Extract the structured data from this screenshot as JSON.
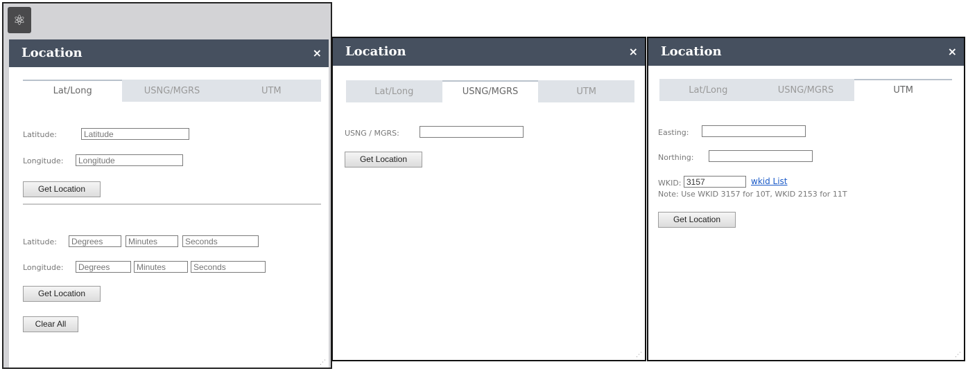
{
  "toolbar": {
    "icon": "location-tool-icon"
  },
  "panel1": {
    "title": "Location",
    "close": "×",
    "tabs": [
      "Lat/Long",
      "USNG/MGRS",
      "UTM"
    ],
    "active_tab": "Lat/Long",
    "decimal": {
      "lat_label": "Latitude:",
      "lat_placeholder": "Latitude",
      "lon_label": "Longitude:",
      "lon_placeholder": "Longitude",
      "button": "Get Location"
    },
    "dms": {
      "lat_label": "Latitude:",
      "lon_label": "Longitude:",
      "deg": "Degrees",
      "min": "Minutes",
      "sec": "Seconds",
      "button": "Get Location",
      "clear": "Clear All"
    }
  },
  "panel2": {
    "title": "Location",
    "close": "×",
    "tabs": [
      "Lat/Long",
      "USNG/MGRS",
      "UTM"
    ],
    "active_tab": "USNG/MGRS",
    "field_label": "USNG / MGRS:",
    "button": "Get Location"
  },
  "panel3": {
    "title": "Location",
    "close": "×",
    "tabs": [
      "Lat/Long",
      "USNG/MGRS",
      "UTM"
    ],
    "active_tab": "UTM",
    "easting_label": "Easting:",
    "northing_label": "Northing:",
    "wkid_label": "WKID:",
    "wkid_value": "3157",
    "wkid_link": "wkid List",
    "note": "Note: Use WKID 3157 for 10T, WKID 2153 for 11T",
    "button": "Get Location"
  },
  "colors": {
    "titlebar": "#46505f",
    "tab_inactive": "#dfe3e8",
    "link": "#1a5ac8"
  }
}
